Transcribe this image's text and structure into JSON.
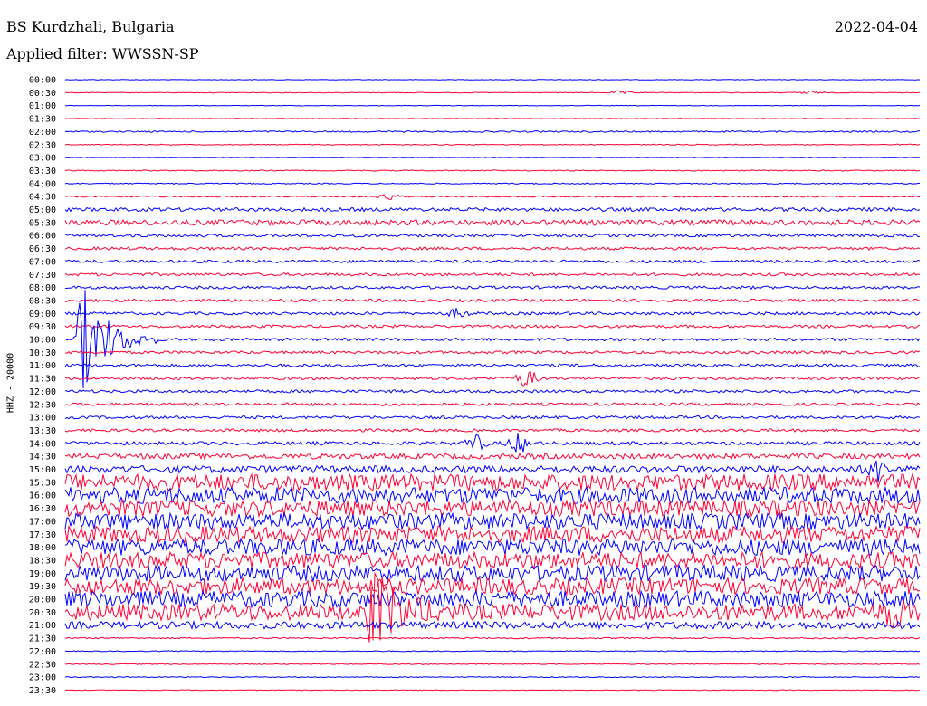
{
  "header": {
    "station": "BS Kurdzhali, Bulgaria",
    "filter": "Applied filter: WWSSN-SP",
    "date": "2022-04-04"
  },
  "channel_label": "HHZ - 20000",
  "chart_data": {
    "type": "line",
    "title": "BS Kurdzhali, Bulgaria",
    "subtitle": "Applied filter: WWSSN-SP",
    "ylabel": "HHZ - 20000",
    "colors": [
      "#0000ff",
      "#ff0033"
    ],
    "time_labels": [
      "00:00",
      "00:30",
      "01:00",
      "01:30",
      "02:00",
      "02:30",
      "03:00",
      "03:30",
      "04:00",
      "04:30",
      "05:00",
      "05:30",
      "06:00",
      "06:30",
      "07:00",
      "07:30",
      "08:00",
      "08:30",
      "09:00",
      "09:30",
      "10:00",
      "10:30",
      "11:00",
      "11:30",
      "12:00",
      "12:30",
      "13:00",
      "13:30",
      "14:00",
      "14:30",
      "15:00",
      "15:30",
      "16:00",
      "16:30",
      "17:00",
      "17:30",
      "18:00",
      "18:30",
      "19:00",
      "19:30",
      "20:00",
      "20:30",
      "21:00",
      "21:30",
      "22:00",
      "22:30",
      "23:00",
      "23:30"
    ],
    "noise_level": [
      0.3,
      0.4,
      0.3,
      0.3,
      0.8,
      0.5,
      0.3,
      0.6,
      0.6,
      0.8,
      2.0,
      3.0,
      1.6,
      1.6,
      1.6,
      1.6,
      1.6,
      1.6,
      1.6,
      1.6,
      1.6,
      1.6,
      1.6,
      1.6,
      1.6,
      1.6,
      1.6,
      1.6,
      2.0,
      3.0,
      4.0,
      9.0,
      9.0,
      9.0,
      9.0,
      9.0,
      9.0,
      9.0,
      9.0,
      9.0,
      9.0,
      9.0,
      4.0,
      0.8,
      0.5,
      0.5,
      0.5,
      0.4
    ],
    "events": [
      {
        "trace": "00:30",
        "x_fraction": 0.65,
        "amplitude": 2
      },
      {
        "trace": "00:30",
        "x_fraction": 0.87,
        "amplitude": 2
      },
      {
        "trace": "04:30",
        "x_fraction": 0.38,
        "amplitude": 3
      },
      {
        "trace": "09:00",
        "x_fraction": 0.46,
        "amplitude": 5
      },
      {
        "trace": "10:00",
        "x_fraction": 0.02,
        "amplitude": 60
      },
      {
        "trace": "11:30",
        "x_fraction": 0.54,
        "amplitude": 10
      },
      {
        "trace": "14:00",
        "x_fraction": 0.48,
        "amplitude": 8
      },
      {
        "trace": "14:00",
        "x_fraction": 0.53,
        "amplitude": 10
      },
      {
        "trace": "15:00",
        "x_fraction": 0.95,
        "amplitude": 12
      },
      {
        "trace": "20:30",
        "x_fraction": 0.36,
        "amplitude": 45
      },
      {
        "trace": "20:30",
        "x_fraction": 0.97,
        "amplitude": 15
      }
    ]
  }
}
